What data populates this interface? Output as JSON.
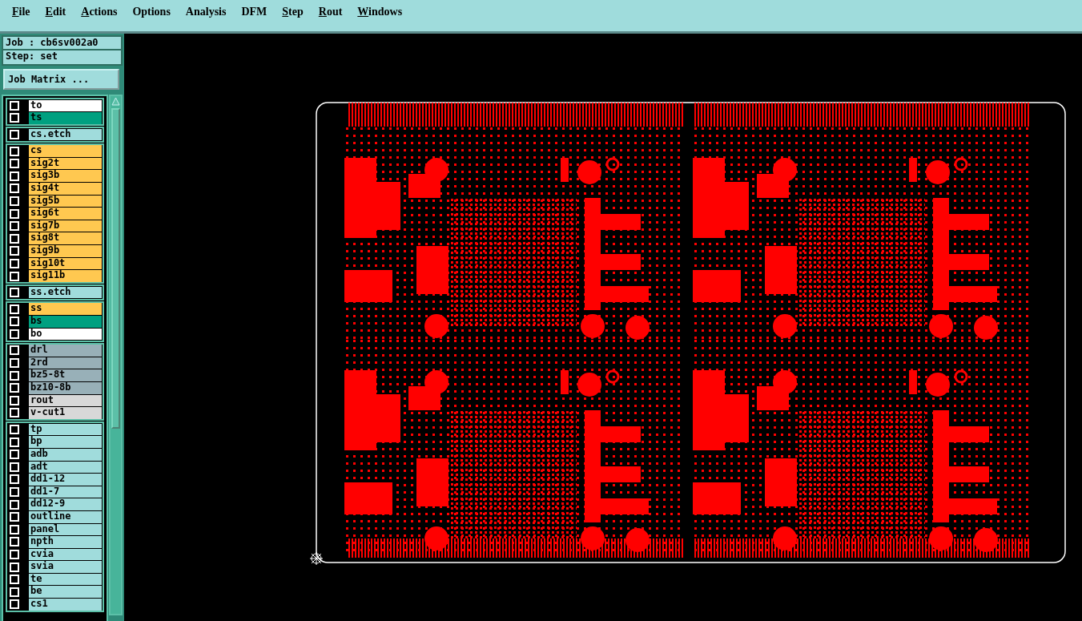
{
  "menu": [
    {
      "label": "File",
      "mnemonic": true
    },
    {
      "label": "Edit",
      "mnemonic": true
    },
    {
      "label": "Actions",
      "mnemonic": true
    },
    {
      "label": "Options",
      "mnemonic": false
    },
    {
      "label": "Analysis",
      "mnemonic": false
    },
    {
      "label": "DFM",
      "mnemonic": false
    },
    {
      "label": "Step",
      "mnemonic": true
    },
    {
      "label": "Rout",
      "mnemonic": true
    },
    {
      "label": "Windows",
      "mnemonic": true
    }
  ],
  "job": "Job : cb6sv002a0",
  "step": "Step: set",
  "job_matrix_button": "Job Matrix ...",
  "layer_groups": [
    {
      "layers": [
        {
          "name": "to",
          "checked": false,
          "color": "#ffffff"
        },
        {
          "name": "ts",
          "checked": false,
          "color": "#00a080"
        }
      ]
    },
    {
      "layers": [
        {
          "name": "cs.etch",
          "checked": false,
          "color": "#a0dcdc"
        }
      ]
    },
    {
      "layers": [
        {
          "name": "cs",
          "checked": false,
          "color": "#ffc850"
        },
        {
          "name": "sig2t",
          "checked": false,
          "color": "#ffc850"
        },
        {
          "name": "sig3b",
          "checked": false,
          "color": "#ffc850"
        },
        {
          "name": "sig4t",
          "checked": false,
          "color": "#ffc850"
        },
        {
          "name": "sig5b",
          "checked": false,
          "color": "#ffc850"
        },
        {
          "name": "sig6t",
          "checked": false,
          "color": "#ffc850"
        },
        {
          "name": "sig7b",
          "checked": false,
          "color": "#ffc850"
        },
        {
          "name": "sig8t",
          "checked": false,
          "color": "#ffc850"
        },
        {
          "name": "sig9b",
          "checked": false,
          "color": "#ffc850"
        },
        {
          "name": "sig10t",
          "checked": false,
          "color": "#ffc850"
        },
        {
          "name": "sig11b",
          "checked": false,
          "color": "#ffc850"
        }
      ]
    },
    {
      "layers": [
        {
          "name": "ss.etch",
          "checked": false,
          "color": "#a0dcdc"
        }
      ]
    },
    {
      "layers": [
        {
          "name": "ss",
          "checked": false,
          "color": "#ffc850"
        },
        {
          "name": "bs",
          "checked": false,
          "color": "#00a080"
        },
        {
          "name": "bo",
          "checked": false,
          "color": "#ffffff"
        }
      ]
    },
    {
      "layers": [
        {
          "name": "drl",
          "checked": false,
          "color": "#98b0b8"
        },
        {
          "name": "2rd",
          "checked": false,
          "color": "#98b0b8"
        },
        {
          "name": "bz5-8t",
          "checked": false,
          "color": "#98b0b8"
        },
        {
          "name": "bz10-8b",
          "checked": false,
          "color": "#98b0b8"
        },
        {
          "name": "rout",
          "checked": false,
          "color": "#d8d8d8"
        },
        {
          "name": "v-cut1",
          "checked": false,
          "color": "#d8d8d8"
        }
      ]
    },
    {
      "layers": [
        {
          "name": "tp",
          "checked": false,
          "color": "#a0dcdc"
        },
        {
          "name": "bp",
          "checked": false,
          "color": "#a0dcdc"
        },
        {
          "name": "adb",
          "checked": false,
          "color": "#a0dcdc"
        },
        {
          "name": "adt",
          "checked": false,
          "color": "#a0dcdc"
        },
        {
          "name": "dd1-12",
          "checked": false,
          "color": "#a0dcdc"
        },
        {
          "name": "dd1-7",
          "checked": false,
          "color": "#a0dcdc"
        },
        {
          "name": "dd12-9",
          "checked": false,
          "color": "#a0dcdc"
        },
        {
          "name": "outline",
          "checked": false,
          "color": "#a0dcdc"
        },
        {
          "name": "panel",
          "checked": false,
          "color": "#a0dcdc"
        },
        {
          "name": "npth",
          "checked": false,
          "color": "#a0dcdc"
        },
        {
          "name": "cvia",
          "checked": false,
          "color": "#a0dcdc"
        },
        {
          "name": "svia",
          "checked": false,
          "color": "#a0dcdc"
        },
        {
          "name": "te",
          "checked": false,
          "color": "#a0dcdc"
        },
        {
          "name": "be",
          "checked": false,
          "color": "#a0dcdc"
        },
        {
          "name": "cs1",
          "checked": false,
          "color": "#a0dcdc"
        }
      ]
    }
  ]
}
